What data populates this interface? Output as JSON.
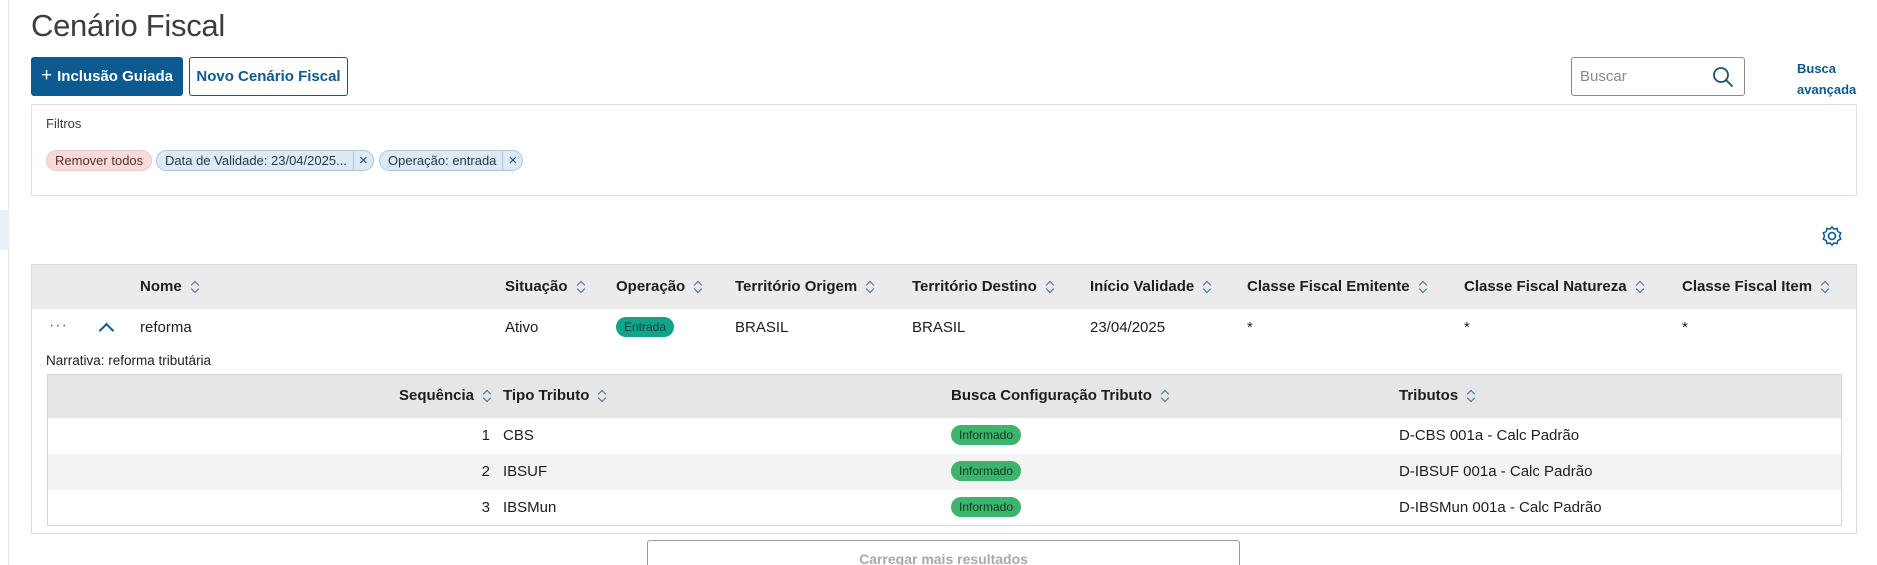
{
  "page": {
    "title": "Cenário Fiscal"
  },
  "toolbar": {
    "guided_label": "Inclusão Guiada",
    "new_label": "Novo Cenário Fiscal",
    "search_placeholder": "Buscar",
    "advanced_search_label": "Busca avançada"
  },
  "filters": {
    "label": "Filtros",
    "remove_all_label": "Remover todos",
    "chips": [
      {
        "label": "Data de Validade: 23/04/2025..."
      },
      {
        "label": "Operação: entrada"
      }
    ]
  },
  "grid": {
    "columns": [
      "Nome",
      "Situação",
      "Operação",
      "Território Origem",
      "Território Destino",
      "Início Validade",
      "Classe Fiscal Emitente",
      "Classe Fiscal Natureza",
      "Classe Fiscal Item"
    ],
    "rows": [
      {
        "nome": "reforma",
        "situacao": "Ativo",
        "operacao": "Entrada",
        "territorio_origem": "BRASIL",
        "territorio_destino": "BRASIL",
        "inicio_validade": "23/04/2025",
        "classe_emitente": "*",
        "classe_natureza": "*",
        "classe_item": "*",
        "narrative_label": "Narrativa:",
        "narrative_value": "reforma tributária"
      }
    ]
  },
  "subgrid": {
    "columns": [
      "Sequência",
      "Tipo Tributo",
      "Busca Configuração Tributo",
      "Tributos"
    ],
    "rows": [
      {
        "sequencia": "1",
        "tipo": "CBS",
        "busca": "Informado",
        "tributos": "D-CBS 001a - Calc Padrão"
      },
      {
        "sequencia": "2",
        "tipo": "IBSUF",
        "busca": "Informado",
        "tributos": "D-IBSUF 001a - Calc Padrão"
      },
      {
        "sequencia": "3",
        "tipo": "IBSMun",
        "busca": "Informado",
        "tributos": "D-IBSMun 001a - Calc Padrão"
      }
    ]
  },
  "footer": {
    "load_more_label": "Carregar mais resultados"
  },
  "colors": {
    "primary": "#0c5a8f",
    "badge_entrada": "#12a48a",
    "badge_informado": "#3db36b",
    "chip_remove": "#f8dada",
    "chip_filter": "#dceaf6"
  },
  "icons": [
    "plus-icon",
    "search-icon",
    "close-icon",
    "settings-icon",
    "more-icon",
    "chevron-up-icon",
    "sort-icon"
  ]
}
